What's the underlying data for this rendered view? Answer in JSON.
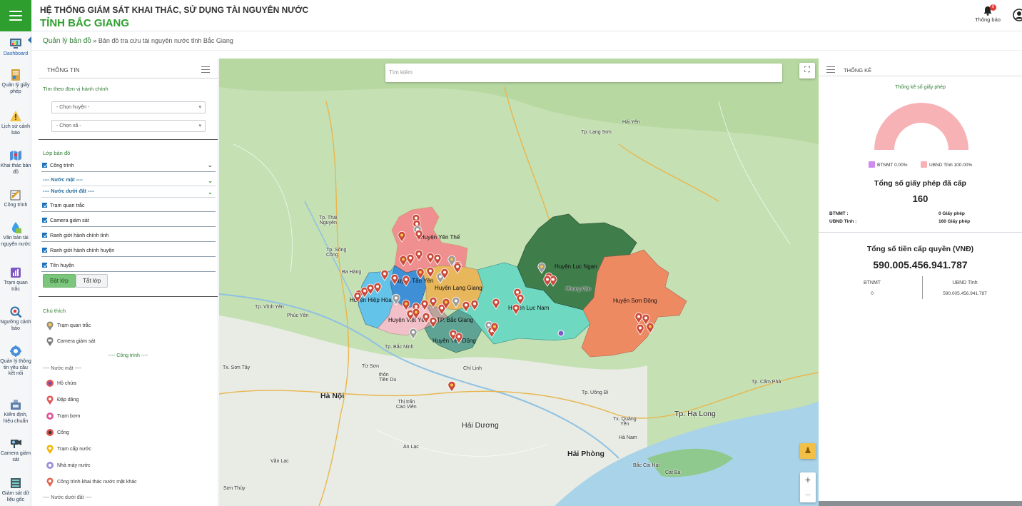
{
  "header": {
    "system_title": "HỆ THỐNG GIÁM SÁT KHAI THÁC, SỬ DỤNG TÀI NGUYÊN NƯỚC",
    "province_title": "TỈNH BẮC GIANG",
    "notification_label": "Thông báo",
    "notification_count": "0"
  },
  "sidebar": {
    "items": [
      {
        "label": "Dashboard",
        "icon": "dashboard-icon"
      },
      {
        "label": "Quản lý giấy phép",
        "icon": "license-icon"
      },
      {
        "label": "Lịch sử cảnh báo",
        "icon": "warning-history-icon"
      },
      {
        "label": "Khai thác bản đồ",
        "icon": "map-icon"
      },
      {
        "label": "Công trình",
        "icon": "construction-icon"
      },
      {
        "label": "Văn bản tài nguyên nước",
        "icon": "document-icon"
      },
      {
        "label": "Trạm quan trắc",
        "icon": "station-icon"
      },
      {
        "label": "Ngưỡng cảnh báo",
        "icon": "threshold-icon"
      },
      {
        "label": "Quản lý thông tin yêu cầu kết nối",
        "icon": "connection-icon"
      },
      {
        "label": "Kiểm định, hiệu chuẩn",
        "icon": "calibration-icon"
      },
      {
        "label": "Camera giám sát",
        "icon": "camera-icon"
      },
      {
        "label": "Giám sát dữ liệu gốc",
        "icon": "data-icon"
      }
    ]
  },
  "breadcrumb": {
    "root": "Quản lý bản đồ",
    "separator": "»",
    "current": "Bản đồ tra cứu tài nguyên nước tỉnh Bắc Giang"
  },
  "left_panel": {
    "title": "THÔNG TIN",
    "admin_filter_label": "Tìm theo đơn vị hành chính",
    "district_select": "- Chọn huyện -",
    "commune_select": "- Chọn xã -",
    "layers_label": "Lớp bản đồ",
    "layers": {
      "works": "Công trình",
      "surface_water": "---- Nước mặt ----",
      "groundwater": "---- Nước dưới đất ----",
      "monitoring_station": "Trạm quan trắc",
      "camera": "Camera giám sát",
      "province_boundary": "Ranh giới hành chính tỉnh",
      "district_boundary": "Ranh giới hành chính huyện",
      "names": "Tên huyện"
    },
    "btn_on": "Bật lớp",
    "btn_off": "Tắt lớp",
    "legend_label": "Chú thích",
    "legend": {
      "station": "Trạm quan trắc",
      "camera": "Camera giám sát",
      "works_head": "---- Công trình ----",
      "surface_head": "---- Nước mặt ----",
      "reservoir": "Hồ chứa",
      "dam": "Đập dâng",
      "pump": "Trạm bơm",
      "sluice": "Cống",
      "water_supply": "Trạm cấp nước",
      "water_plant": "Nhà máy nước",
      "other_surface": "Công trình khai thác nước mặt khác",
      "ground_head": "---- Nước dưới đất ----"
    }
  },
  "map": {
    "search_placeholder": "Tìm kiếm",
    "districts": {
      "yen_the": "Huyện Yên Thế",
      "tan_yen": "Huyện Tân Yên",
      "lang_giang": "Huyện Lạng Giang",
      "luc_ngan": "Huyện Lục Ngạn",
      "luc_nam": "Huyện Lục Nam",
      "son_dong": "Huyện Sơn Động",
      "hiep_hoa": "Huyện Hiệp Hòa",
      "viet_yen": "Huyện Việt Yên",
      "bac_giang": "TP. Bắc Giang",
      "yen_dung": "Huyện Yên Dũng"
    },
    "places": {
      "thai_nguyen": "Tp. Thái\nNguyên",
      "song_cong": "Tp. Sông\nCông",
      "ha_noi": "Hà Nội",
      "hai_duong": "Hải Dương",
      "hai_phong": "Hải Phòng",
      "ha_long": "Tp. Hạ Long",
      "cam_pha": "Tp. Cẩm Phả",
      "uong_bi": "Tp. Uông Bí",
      "bac_ninh": "Tp. Bắc Ninh",
      "lang_son": "Tp. Lạng Sơn",
      "phuc_yen": "Phúc Yên",
      "vinh_yen": "Tp. Vĩnh Yên",
      "son_tay": "Tx. Sơn Tây",
      "chi_linh": "Chí Linh",
      "tu_son": "Từ Sơn",
      "ba_hang": "Ba Hàng",
      "hai_yen": "Hải Yên",
      "phong_van": "Phong Vân",
      "thuan_thanh": "thôn\nTiền Du",
      "cao_vien": "Thị trấn\nCao Viên",
      "an_lac": "An Lạc",
      "ha_nam": "Hà Nam",
      "quang_yen": "Tx. Quảng\nYên",
      "cat_ba": "Cát Bà",
      "bac_cai_hai": "Bắc Cái Hải",
      "son_thuy": "Sơn Thủy",
      "van_lac": "Văn Lạc"
    },
    "colors": {
      "base": "#c9e3b8",
      "yen_the": "#ef8f8f",
      "tan_yen": "#3f8fd6",
      "lang_giang": "#e8b65b",
      "luc_ngan": "#3f7d4b",
      "luc_nam": "#6fd8c1",
      "son_dong": "#ee8a62",
      "hiep_hoa": "#63c3e8",
      "viet_yen": "#f2c0c8",
      "yen_dung": "#5fa394"
    }
  },
  "right_panel": {
    "title": "THỐNG KÊ",
    "gauge_title": "Thống kê số giấy phép",
    "legend_btnmt": "BTNMT 0.00%",
    "legend_ubnd": "UBND Tỉnh 100.00%",
    "total_license_label": "Tổng số giấy phép đã cấp",
    "total_license_value": "160",
    "btnmt_label": "BTNMT :",
    "btnmt_value": "0 Giấy phép",
    "ubnd_label": "UBND Tỉnh :",
    "ubnd_value": "160 Giấy phép",
    "total_fee_label": "Tổng số tiền cấp quyền (VNĐ)",
    "total_fee_value": "590.005.456.941.787",
    "fee_btnmt_label": "BTNMT",
    "fee_btnmt_value": "0",
    "fee_ubnd_label": "UBND Tỉnh",
    "fee_ubnd_value": "590.005.456.941.787",
    "share_btnmt": 0.0,
    "share_ubnd": 100.0,
    "color_btnmt": "#cf8cf0",
    "color_ubnd": "#f7b2b6"
  }
}
